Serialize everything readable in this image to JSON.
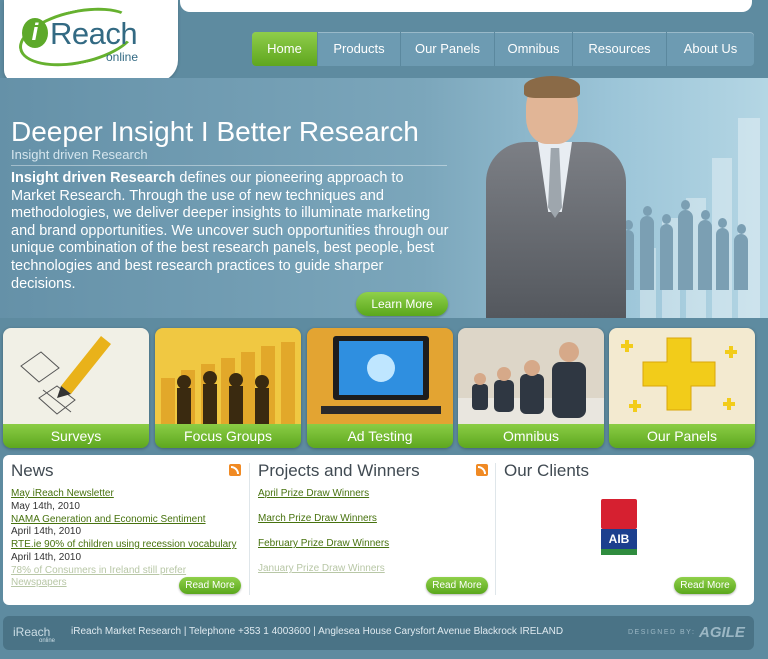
{
  "logo": {
    "initial": "i",
    "name": "Reach",
    "suffix": "online"
  },
  "nav": [
    {
      "label": "Home",
      "active": true
    },
    {
      "label": "Products",
      "active": false
    },
    {
      "label": "Our Panels",
      "active": false
    },
    {
      "label": "Omnibus",
      "active": false
    },
    {
      "label": "Resources",
      "active": false
    },
    {
      "label": "About Us",
      "active": false
    }
  ],
  "hero": {
    "title": "Deeper Insight I Better Research",
    "subtitle": "Insight driven Research",
    "body_bold": "Insight driven Research",
    "body_rest": " defines our pioneering approach to Market Research. Through the use of new techniques and methodologies, we deliver deeper insights to illuminate marketing and brand opportunities. We uncover such opportunities through our unique combination of the best research panels, best people, best technologies and best research practices to guide sharper decisions.",
    "button": "Learn More"
  },
  "tiles": [
    {
      "label": "Surveys"
    },
    {
      "label": "Focus Groups"
    },
    {
      "label": "Ad Testing"
    },
    {
      "label": "Omnibus"
    },
    {
      "label": "Our Panels"
    }
  ],
  "news": {
    "title": "News",
    "items": [
      {
        "link": "May iReach Newsletter",
        "date": "May 14th, 2010"
      },
      {
        "link": "NAMA Generation and Economic Sentiment",
        "date": "April 14th, 2010"
      },
      {
        "link": "RTE.ie 90% of children using recession vocabulary",
        "date": "April 14th, 2010"
      }
    ],
    "faded": "78% of Consumers in Ireland still prefer Newspapers",
    "read_more": "Read More"
  },
  "projects": {
    "title": "Projects and Winners",
    "items": [
      "April Prize Draw Winners",
      "March Prize Draw Winners",
      "February Prize Draw Winners"
    ],
    "faded": "January Prize Draw Winners",
    "read_more": "Read More"
  },
  "clients": {
    "title": "Our Clients",
    "logo_text": "AIB",
    "read_more": "Read More"
  },
  "footer": {
    "logo": "iReach",
    "logo_sub": "online",
    "text": "iReach Market Research  |  Telephone +353 1 4003600  |  Anglesea House Carysfort Avenue Blackrock IRELAND",
    "designed_by": "DESIGNED BY:",
    "agency": "AGILE"
  },
  "colors": {
    "accent_green": "#66b12f",
    "brand_blue": "#336a83",
    "background": "#5e8ba0"
  }
}
